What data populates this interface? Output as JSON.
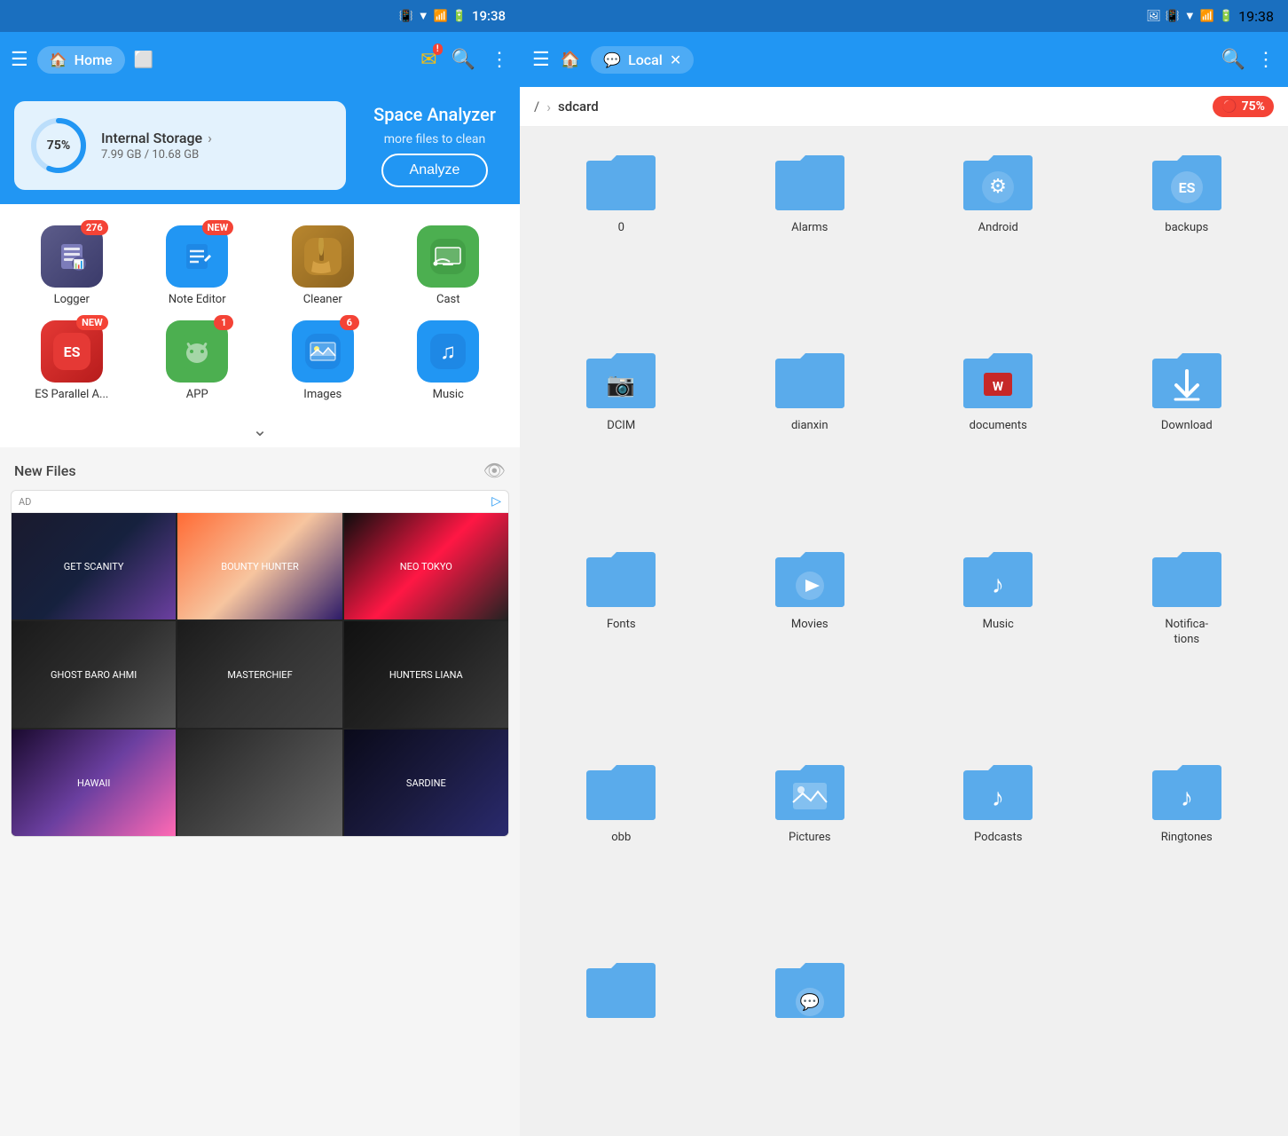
{
  "left": {
    "status": {
      "time": "19:38"
    },
    "nav": {
      "menu_icon": "☰",
      "home_label": "Home",
      "more_icon": "⋮",
      "search_icon": "🔍"
    },
    "storage": {
      "title": "Internal Storage",
      "used_gb": "7.99 GB",
      "total_gb": "10.68 GB",
      "percent": 75,
      "analyzer_title": "Space Analyzer",
      "analyzer_sub": "more files to clean",
      "analyze_btn": "Analyze"
    },
    "apps": [
      {
        "id": "logger",
        "label": "Logger",
        "badge": "276",
        "badge_type": "number",
        "icon": "📋"
      },
      {
        "id": "note-editor",
        "label": "Note Editor",
        "badge": "NEW",
        "badge_type": "new",
        "icon": "📝"
      },
      {
        "id": "cleaner",
        "label": "Cleaner",
        "badge": "",
        "badge_type": "none",
        "icon": "🧹"
      },
      {
        "id": "cast",
        "label": "Cast",
        "badge": "",
        "badge_type": "none",
        "icon": "📺"
      },
      {
        "id": "es-parallel",
        "label": "ES Parallel A...",
        "badge": "NEW",
        "badge_type": "new",
        "icon": "📱"
      },
      {
        "id": "app",
        "label": "APP",
        "badge": "1",
        "badge_type": "number",
        "icon": "🤖"
      },
      {
        "id": "images",
        "label": "Images",
        "badge": "6",
        "badge_type": "number",
        "icon": "🖼"
      },
      {
        "id": "music",
        "label": "Music",
        "badge": "",
        "badge_type": "none",
        "icon": "🎵"
      }
    ],
    "new_files": {
      "title": "New Files",
      "ad_label": "AD"
    }
  },
  "right": {
    "status": {
      "time": "19:38"
    },
    "nav": {
      "menu_icon": "☰",
      "local_label": "Local",
      "search_icon": "🔍",
      "more_icon": "⋮"
    },
    "breadcrumb": {
      "root": "/",
      "sep": "›",
      "current": "sdcard",
      "usage": "75%"
    },
    "folders": [
      {
        "id": "folder-0",
        "label": "0",
        "icon_type": "plain"
      },
      {
        "id": "folder-alarms",
        "label": "Alarms",
        "icon_type": "plain"
      },
      {
        "id": "folder-android",
        "label": "Android",
        "icon_type": "gear"
      },
      {
        "id": "folder-backups",
        "label": "backups",
        "icon_type": "es"
      },
      {
        "id": "folder-dcim",
        "label": "DCIM",
        "icon_type": "camera"
      },
      {
        "id": "folder-dianxin",
        "label": "dianxin",
        "icon_type": "plain"
      },
      {
        "id": "folder-documents",
        "label": "documents",
        "icon_type": "wps"
      },
      {
        "id": "folder-download",
        "label": "Download",
        "icon_type": "download"
      },
      {
        "id": "folder-fonts",
        "label": "Fonts",
        "icon_type": "plain"
      },
      {
        "id": "folder-movies",
        "label": "Movies",
        "icon_type": "play"
      },
      {
        "id": "folder-music",
        "label": "Music",
        "icon_type": "music"
      },
      {
        "id": "folder-notifications",
        "label": "Notifications",
        "icon_type": "plain"
      },
      {
        "id": "folder-obb",
        "label": "obb",
        "icon_type": "plain"
      },
      {
        "id": "folder-pictures",
        "label": "Pictures",
        "icon_type": "image"
      },
      {
        "id": "folder-podcasts",
        "label": "Podcasts",
        "icon_type": "music"
      },
      {
        "id": "folder-ringtones",
        "label": "Ringtones",
        "icon_type": "music"
      }
    ]
  }
}
